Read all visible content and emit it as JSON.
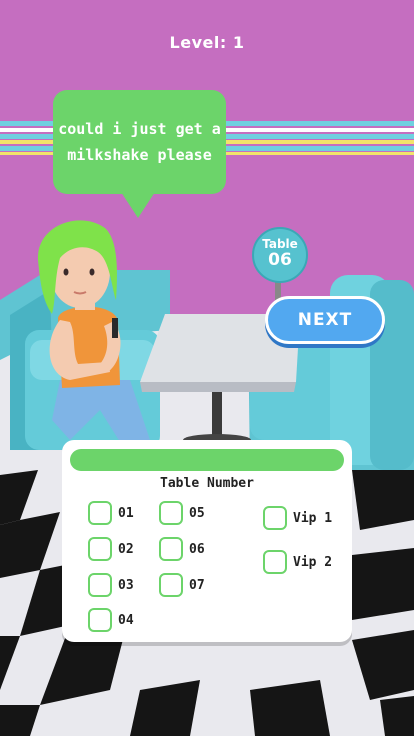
{
  "hud": {
    "level_label": "Level: 1"
  },
  "speech_bubble": {
    "text": "could i just get a\nmilkshake please"
  },
  "table_sign": {
    "line1": "Table",
    "line2": "06"
  },
  "next_button": {
    "label": "NEXT"
  },
  "selection_panel": {
    "title": "Table Number",
    "options": [
      "01",
      "02",
      "03",
      "04",
      "05",
      "06",
      "07",
      "Vip 1",
      "Vip 2"
    ]
  },
  "colors": {
    "wall": "#c56ec0",
    "accent_green": "#6cd46a",
    "booth_cyan": "#56c2cf",
    "next_blue": "#52a8f0"
  }
}
